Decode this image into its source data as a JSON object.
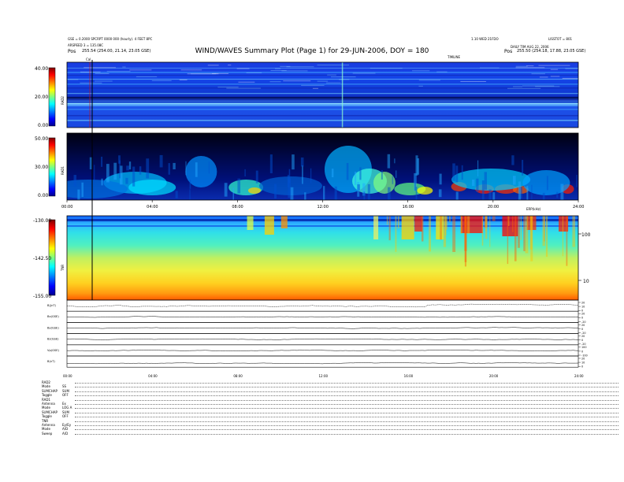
{
  "header": {
    "title": "WIND/WAVES Summary Plot (Page 1) for 29-JUN-2006, DOY = 180",
    "left_line1": "GSE = 0.2000 SPCRPT 0000 000 (hourly). 4 FEET 8PC",
    "left_line2": "ARSPEED 3 = 135.08C",
    "left_line3_label": "Pos",
    "left_line3": "255.54 (254.00, 21.14, 23.05 GSE)",
    "center_right": "1.10 WED 21FDO",
    "right_line1": "LISSTOT = 801",
    "right_line2": "DAILY  TIM AUG 22, 2006",
    "right_line3_label": "Pos",
    "right_line3": "255.50 (254.18, 17.88, 23.05 GSE)",
    "marker_left": "Cal",
    "marker_right": "TIMLINE"
  },
  "colors": {
    "rainbow_low": "#00008f",
    "rainbow_high": "#ff0000",
    "trace": "#000000"
  },
  "chart_data": [
    {
      "type": "heatmap",
      "name": "RAD2",
      "ylabel": "RAD2",
      "y_ticks": [
        "40.00",
        "20.00",
        "0.00"
      ],
      "colorbar": "rainbow",
      "x_range_hours": [
        0,
        24
      ]
    },
    {
      "type": "heatmap",
      "name": "RAD1",
      "ylabel": "RAD1",
      "y_ticks": [
        "50.00",
        "30.00",
        "0.00"
      ],
      "colorbar": "rainbow",
      "x_ticks": [
        "00:00",
        "04:00",
        "08:00",
        "12:00",
        "16:00",
        "20:00",
        "24:00"
      ],
      "x_range_hours": [
        0,
        24
      ]
    },
    {
      "type": "heatmap",
      "name": "TNR",
      "ylabel": "TNR",
      "y_ticks": [
        "-130.00",
        "-142.50",
        "-155.00"
      ],
      "right_ticks": [
        "100",
        "10"
      ],
      "right_label": "ERP(kHz)",
      "colorbar": "rainbow",
      "x_range_hours": [
        0,
        24
      ]
    },
    {
      "type": "line",
      "panels": [
        {
          "label": "B|(nT)",
          "right_ticks": [
            "20",
            "10",
            "0"
          ]
        },
        {
          "label": "Bx(GSE)",
          "right_ticks": [
            "20",
            "0",
            "-20"
          ]
        },
        {
          "label": "By(GSE)",
          "right_ticks": [
            "20",
            "0",
            "-20"
          ]
        },
        {
          "label": "Bz(GSE)",
          "right_ticks": [
            "20",
            "0",
            "-20"
          ]
        },
        {
          "label": "Vp(GSE)",
          "right_ticks": [
            "100",
            "0",
            "-100"
          ]
        },
        {
          "label": "B(nT)",
          "right_ticks": [
            "20",
            "10",
            "0"
          ]
        }
      ],
      "x_ticks": [
        "00:00",
        "04:00",
        "08:00",
        "12:00",
        "16:00",
        "20:00",
        "24:00"
      ],
      "x_range_hours": [
        0,
        24
      ]
    }
  ],
  "footer": {
    "rows": [
      {
        "k": "RAD2",
        "v": ""
      },
      {
        "k": "Mode",
        "v": "SS"
      },
      {
        "k": "SUMCHAP",
        "v": "SUM"
      },
      {
        "k": "Toggle",
        "v": "OFF"
      },
      {
        "k": "RAD1",
        "v": ""
      },
      {
        "k": "Antenna",
        "v": "Ex"
      },
      {
        "k": "Mode",
        "v": "LOG A"
      },
      {
        "k": "SUMCHAP",
        "v": "SUM"
      },
      {
        "k": "Toggle",
        "v": "OFF"
      },
      {
        "k": "TNR",
        "v": ""
      },
      {
        "k": "Antenna",
        "v": "Ey/Ey"
      },
      {
        "k": "Mode",
        "v": "A/D"
      },
      {
        "k": "Sweep",
        "v": "A/D"
      }
    ]
  }
}
